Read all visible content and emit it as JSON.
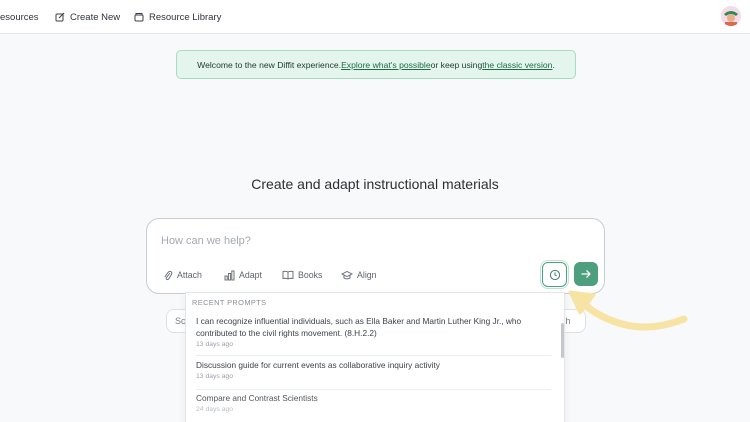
{
  "nav": {
    "items": [
      {
        "label": "esources",
        "icon": "none"
      },
      {
        "label": "Create New",
        "icon": "pencil-square-icon"
      },
      {
        "label": "Resource Library",
        "icon": "folder-icon"
      }
    ]
  },
  "banner": {
    "prefix": "Welcome to the new Diffit experience. ",
    "link_explore": "Explore what's possible",
    "middle": " or keep using ",
    "link_classic": "the classic version",
    "suffix": "."
  },
  "headline": "Create and adapt instructional materials",
  "prompt": {
    "placeholder": "How can we help?",
    "value": "",
    "tools": [
      {
        "label": "Attach",
        "icon": "paperclip-icon"
      },
      {
        "label": "Adapt",
        "icon": "bar-chart-icon"
      },
      {
        "label": "Books",
        "icon": "open-book-icon"
      },
      {
        "label": "Align",
        "icon": "graduation-cap-icon"
      }
    ],
    "history_icon": "clock-icon",
    "send_icon": "arrow-right-icon"
  },
  "background_search": {
    "left_text": "Sc",
    "right_text": "ch"
  },
  "recent": {
    "title": "Recent prompts",
    "items": [
      {
        "text": "I can recognize influential individuals, such as Ella Baker and Martin Luther King Jr., who contributed to the civil rights movement. (8.H.2.2)",
        "date": "13 days ago"
      },
      {
        "text": "Discussion guide for current events as collaborative inquiry activity",
        "date": "13 days ago"
      },
      {
        "text": "Compare and Contrast Scientists",
        "date": "24 days ago"
      }
    ]
  },
  "colors": {
    "accent": "#4e9f7d",
    "banner_bg": "#e3f5ec",
    "highlight_arrow": "#f7e3a3"
  }
}
